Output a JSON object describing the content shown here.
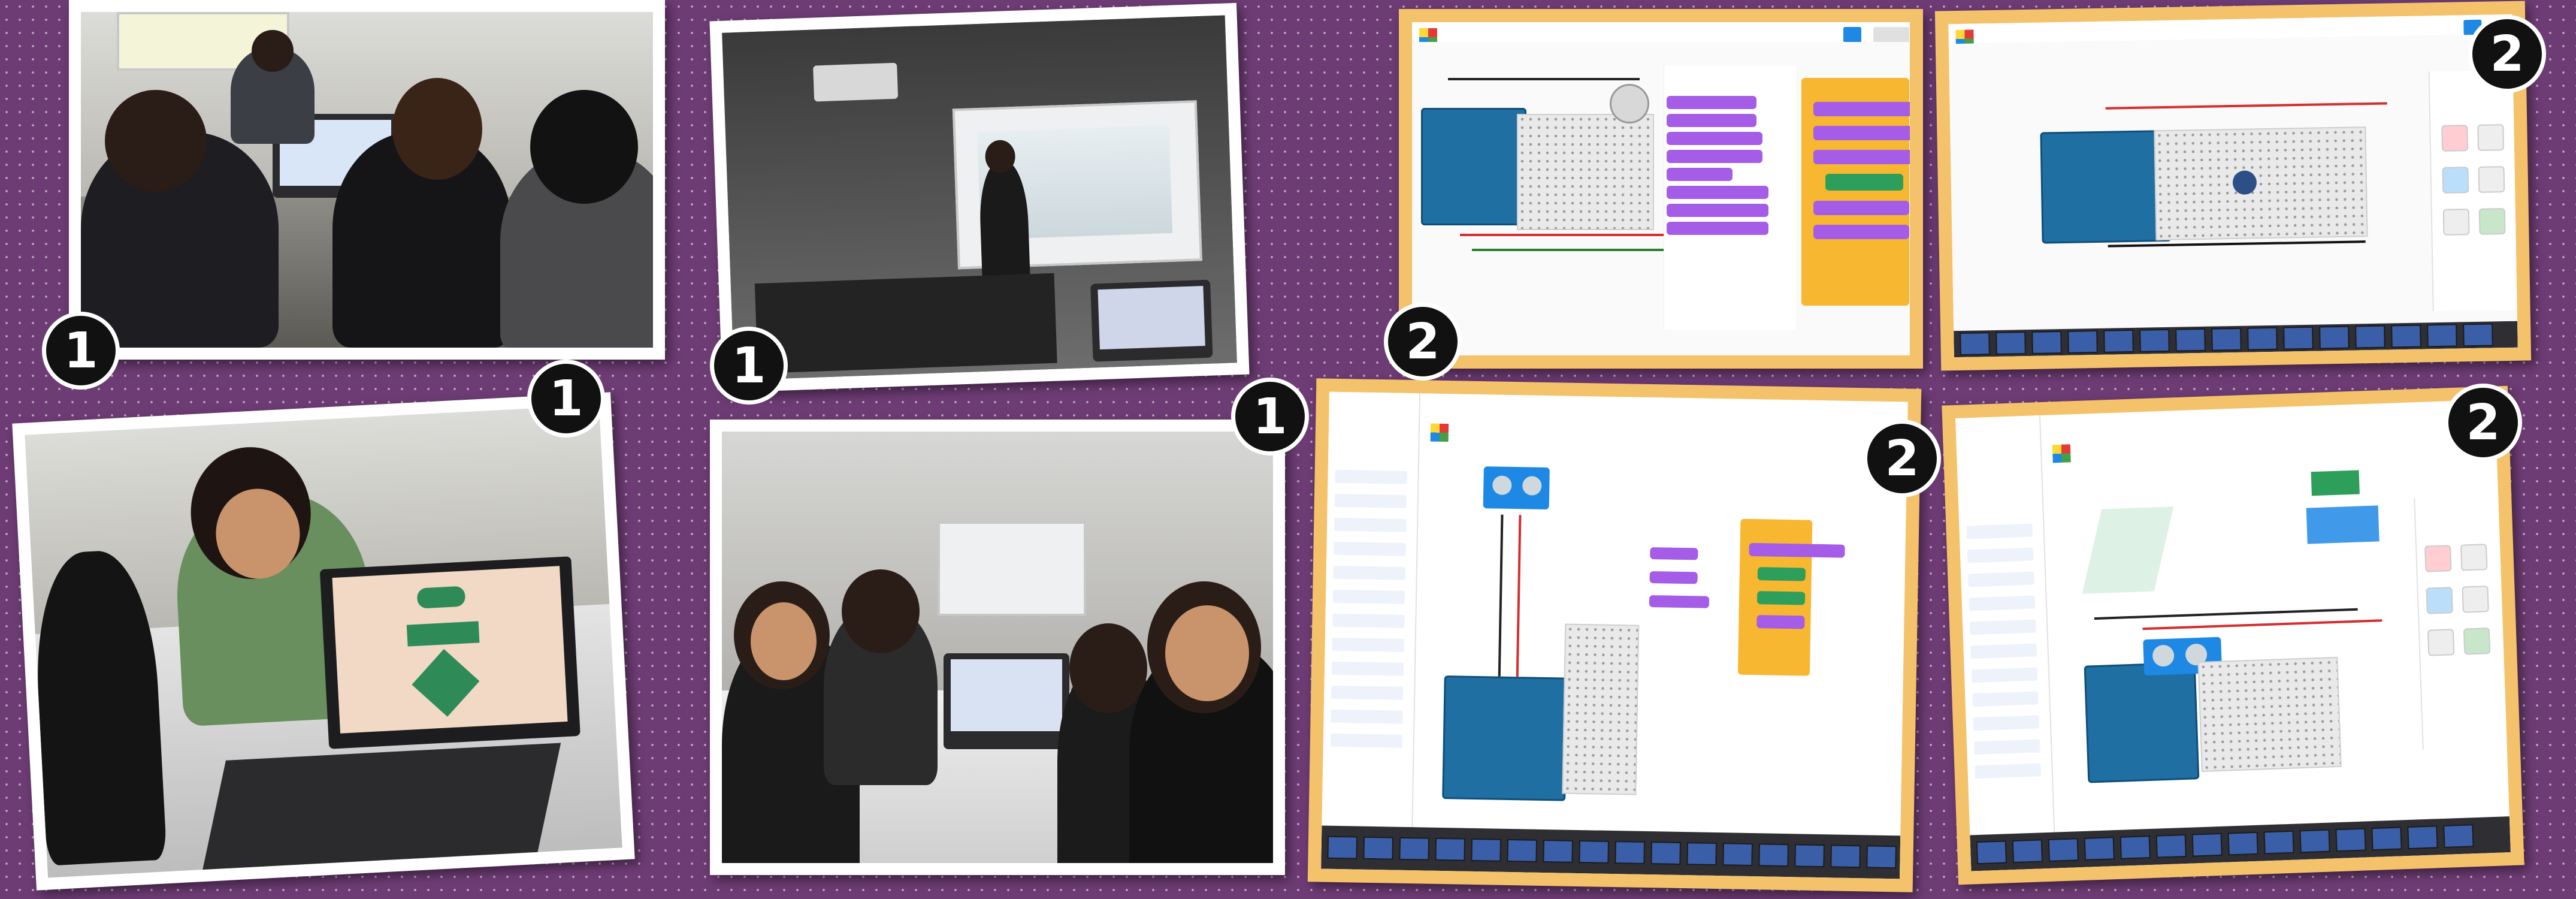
{
  "badges": {
    "photo_1": "1",
    "photo_2": "1",
    "photo_3": "1",
    "photo_4": "1",
    "shot_1": "2",
    "shot_2": "2",
    "shot_3": "2",
    "shot_4": "2"
  },
  "colors": {
    "background": "#6e3c75",
    "photo_frame": "#ffffff",
    "screenshot_frame": "#f4c26a",
    "badge": "#111111"
  },
  "icons": {
    "tinkercad_logo": "tinkercad-logo-icon",
    "arduino_board": "arduino-board-icon"
  }
}
